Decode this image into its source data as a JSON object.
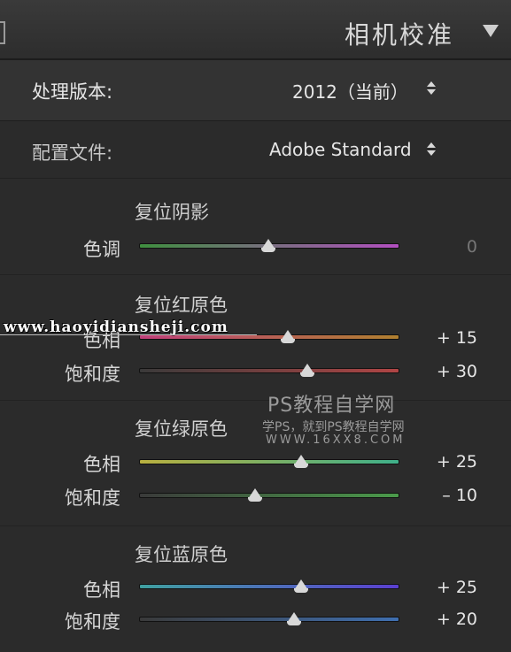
{
  "header": {
    "title": "相机校准"
  },
  "process": {
    "label": "处理版本:",
    "value": "2012（当前）"
  },
  "profile": {
    "label": "配置文件:",
    "value": "Adobe Standard"
  },
  "shadows": {
    "title": "复位阴影",
    "sliders": [
      {
        "label": "色调",
        "value": "0",
        "level": 0.5
      }
    ]
  },
  "red": {
    "title": "复位红原色",
    "sliders": [
      {
        "label": "色相",
        "value": "+ 15",
        "level": 0.575
      },
      {
        "label": "饱和度",
        "value": "+ 30",
        "level": 0.65
      }
    ]
  },
  "green": {
    "title": "复位绿原色",
    "sliders": [
      {
        "label": "色相",
        "value": "+ 25",
        "level": 0.625
      },
      {
        "label": "饱和度",
        "value": "– 10",
        "level": 0.45
      }
    ]
  },
  "blue": {
    "title": "复位蓝原色",
    "sliders": [
      {
        "label": "色相",
        "value": "+ 25",
        "level": 0.625
      },
      {
        "label": "饱和度",
        "value": "+ 20",
        "level": 0.6
      }
    ]
  },
  "watermark": {
    "site": "www.haoyidiansheji.com",
    "brand": "PS教程自学网",
    "tagline": "学PS，就到PS教程自学网",
    "url": "WWW.16XX8.COM"
  },
  "colors": {
    "shadows_tint": [
      "#3f8f3f",
      "#b24fc0"
    ],
    "red_hue": [
      "#c0407a",
      "#b08030"
    ],
    "red_sat": [
      "#3a3a3a",
      "#b04545"
    ],
    "green_hue": [
      "#b9b040",
      "#3fb08a"
    ],
    "green_sat": [
      "#3a3a3a",
      "#4a9a4a"
    ],
    "blue_hue": [
      "#3fa0a0",
      "#5a3fd0"
    ],
    "blue_sat": [
      "#3a3a3a",
      "#3f6fb0"
    ]
  }
}
